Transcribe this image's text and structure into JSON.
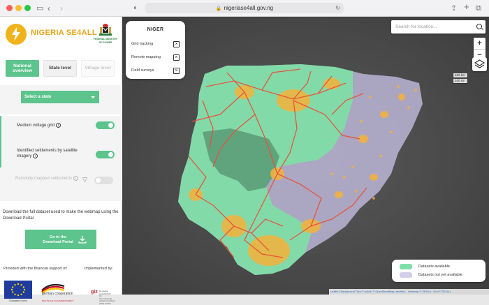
{
  "browser": {
    "url": "nigeriase4all.gov.ng"
  },
  "sidebar": {
    "logo_text": "NIGERIA SE4ALL",
    "ministry_text": "FEDERAL MINISTRY OF POWER",
    "tabs": [
      {
        "label": "National overview",
        "active": true
      },
      {
        "label": "State level",
        "active": false
      },
      {
        "label": "Village level",
        "active": false
      }
    ],
    "state_select_label": "Select a state",
    "layers": [
      {
        "label": "Medium voltage grid",
        "on": true
      },
      {
        "label": "Identified settlements by satellite imagery",
        "on": true
      },
      {
        "label": "Remotely mapped settlements",
        "on": false
      }
    ],
    "download_text": "Download the full dataset used to make the webmap using the Download Portal",
    "download_button": "Go to the Download Portal",
    "support_label": "Provided with the financial support of:",
    "implemented_label": "Implemented by:",
    "eu_caption": "European Union",
    "gc_text": "german cooperation",
    "gc_sub": "DEUTSCHE ZUSAMMENARBEIT",
    "giz_text": "giz",
    "giz_sub": "Deutsche Gesellschaft für Internationale Zusammenarbeit (GIZ) GmbH"
  },
  "map": {
    "niger_card": {
      "title": "NIGER",
      "items": [
        "Grid tracking",
        "Remote mapping",
        "Field surveys"
      ]
    },
    "search_placeholder": "Search for location...",
    "zoom_in": "+",
    "zoom_out": "−",
    "scale": [
      "100 km",
      "100 mi"
    ],
    "legend": [
      {
        "label": "Datasets available",
        "color": "#7ee0a6"
      },
      {
        "label": "Datasets not yet available",
        "color": "#d4cfe8"
      }
    ],
    "attribution": "Leaflet | Background Tiles © se4all, © OpenStreetMap, aerifabs... Heatmap © SE4ALL, Grid © SE4ALL",
    "colors": {
      "available": "#7ee0a6",
      "not_available": "#bbb5d6",
      "grid": "#e8503a",
      "heat": "#f4b23a"
    }
  }
}
